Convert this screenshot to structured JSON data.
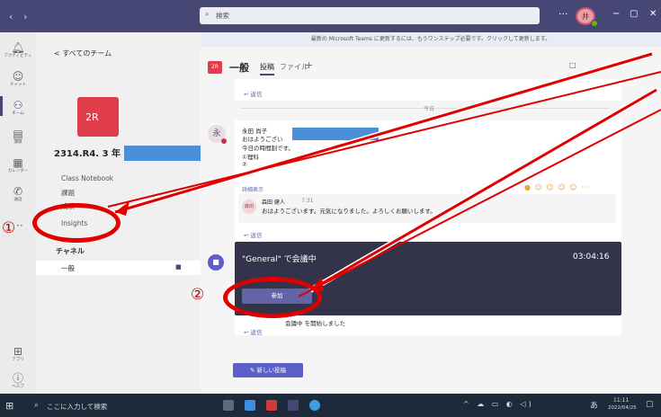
{
  "titlebar": {
    "nav_back": "‹",
    "nav_forward": "›",
    "search_placeholder": "検索",
    "more": "···",
    "avatar_text": "井",
    "minimize": "−",
    "maximize": "▢",
    "close": "✕"
  },
  "rail": {
    "items": [
      {
        "icon": "bell-icon",
        "glyph": "🔔",
        "label": "アクティビティ"
      },
      {
        "icon": "chat-icon",
        "glyph": "💬",
        "label": "チャット"
      },
      {
        "icon": "teams-icon",
        "glyph": "👥",
        "label": "チーム"
      },
      {
        "icon": "assignments-icon",
        "glyph": "📋",
        "label": "課題"
      },
      {
        "icon": "calendar-icon",
        "glyph": "📅",
        "label": "カレンダー"
      },
      {
        "icon": "phone-icon",
        "glyph": "📞",
        "label": "通話"
      },
      {
        "icon": "more-icon",
        "glyph": "···",
        "label": ""
      },
      {
        "icon": "apps-icon",
        "glyph": "⊞",
        "label": "アプリ"
      },
      {
        "icon": "help-icon",
        "glyph": "?",
        "label": "ヘルプ"
      }
    ],
    "active_color": "#464775"
  },
  "panel": {
    "back_label": "< すべてのチーム",
    "team_tile": "2R",
    "team_name": "2314.R4. 3 年 3 組",
    "team_more": "···",
    "links": [
      "Class Notebook",
      "課題",
      "成績",
      "Insights"
    ],
    "channels_heading": "チャネル",
    "channel_general": "一般"
  },
  "main": {
    "banner": "最新の Microsoft Teams に更新するには、もうワンステップ必要です。クリックして更新します。",
    "header_icon": "2R",
    "header_title": "一般",
    "tab_posts": "投稿",
    "tab_files": "ファイル",
    "tab_add": "+",
    "prev_reply": "返信",
    "date_separator": "今日",
    "message": {
      "avatar": "永",
      "author": "永田 尚子",
      "lines": [
        "おはようござい",
        "今日の時間割です。",
        "①理科",
        "②"
      ],
      "see_more": "詳細表示",
      "reactions": "● ☺ ☺ ☺ ☺ ···",
      "reply_avatar": "森田",
      "reply_author": "森田 健人",
      "reply_time": "7:31",
      "reply_text": "おはようございます。元気になりました。よろしくお願いします。",
      "reply_label": "返信"
    },
    "meeting": {
      "title": "\"General\" で会議中",
      "timer": "03:04:16",
      "join_label": "参加",
      "started_text": "会議中 を開始しました",
      "reply_label": "返信"
    },
    "new_post_label": "新しい投稿"
  },
  "taskbar": {
    "search_placeholder": "ここに入力して検索",
    "time": "11:11",
    "date": "2022/04/25",
    "ime": "あ"
  },
  "annotations": {
    "marker_1": "①",
    "marker_2": "②",
    "color": "#e00000"
  }
}
